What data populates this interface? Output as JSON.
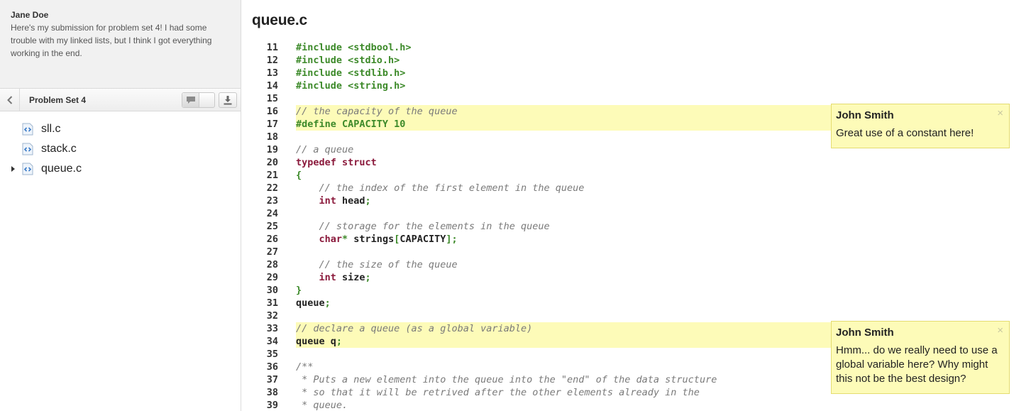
{
  "submission": {
    "author": "Jane Doe",
    "message": "Here's my submission for problem set 4! I had some trouble with my linked lists, but I think I got everything working in the end."
  },
  "problem_set": {
    "title": "Problem Set 4",
    "back_icon": "chevron-left-icon",
    "comment_icon": "speech-bubble-icon",
    "download_icon": "download-icon"
  },
  "files": [
    {
      "name": "sll.c",
      "icon": "code-file-icon",
      "expanded": false
    },
    {
      "name": "stack.c",
      "icon": "code-file-icon",
      "expanded": false
    },
    {
      "name": "queue.c",
      "icon": "code-file-icon",
      "expanded": true
    }
  ],
  "editor": {
    "file_title": "queue.c",
    "lines": [
      {
        "n": "11",
        "text": "#include <stdbool.h>",
        "kind": "pre",
        "hl": false
      },
      {
        "n": "12",
        "text": "#include <stdio.h>",
        "kind": "pre",
        "hl": false
      },
      {
        "n": "13",
        "text": "#include <stdlib.h>",
        "kind": "pre",
        "hl": false
      },
      {
        "n": "14",
        "text": "#include <string.h>",
        "kind": "pre",
        "hl": false
      },
      {
        "n": "15",
        "text": "",
        "kind": "id",
        "hl": false
      },
      {
        "n": "16",
        "text": "// the capacity of the queue",
        "kind": "com",
        "hl": true
      },
      {
        "n": "17",
        "text": "#define CAPACITY 10",
        "kind": "pre",
        "hl": true
      },
      {
        "n": "18",
        "text": "",
        "kind": "id",
        "hl": false
      },
      {
        "n": "19",
        "text": "// a queue",
        "kind": "com",
        "hl": false
      },
      {
        "n": "20",
        "text": "typedef struct",
        "kind": "kw",
        "hl": false
      },
      {
        "n": "21",
        "text": "{",
        "kind": "pun",
        "hl": false
      },
      {
        "n": "22",
        "text": "    // the index of the first element in the queue",
        "kind": "com",
        "hl": false
      },
      {
        "n": "23",
        "text": "    int head;",
        "kind": "mixed",
        "hl": false
      },
      {
        "n": "24",
        "text": "",
        "kind": "id",
        "hl": false
      },
      {
        "n": "25",
        "text": "    // storage for the elements in the queue",
        "kind": "com",
        "hl": false
      },
      {
        "n": "26",
        "text": "    char* strings[CAPACITY];",
        "kind": "mixed",
        "hl": false
      },
      {
        "n": "27",
        "text": "",
        "kind": "id",
        "hl": false
      },
      {
        "n": "28",
        "text": "    // the size of the queue",
        "kind": "com",
        "hl": false
      },
      {
        "n": "29",
        "text": "    int size;",
        "kind": "mixed",
        "hl": false
      },
      {
        "n": "30",
        "text": "}",
        "kind": "pun",
        "hl": false
      },
      {
        "n": "31",
        "text": "queue;",
        "kind": "mixed",
        "hl": false
      },
      {
        "n": "32",
        "text": "",
        "kind": "id",
        "hl": false
      },
      {
        "n": "33",
        "text": "// declare a queue (as a global variable)",
        "kind": "com",
        "hl": true
      },
      {
        "n": "34",
        "text": "queue q;",
        "kind": "mixed",
        "hl": true
      },
      {
        "n": "35",
        "text": "",
        "kind": "id",
        "hl": false
      },
      {
        "n": "36",
        "text": "/**",
        "kind": "com",
        "hl": false
      },
      {
        "n": "37",
        "text": " * Puts a new element into the queue into the \"end\" of the data structure",
        "kind": "com",
        "hl": false
      },
      {
        "n": "38",
        "text": " * so that it will be retrived after the other elements already in the",
        "kind": "com",
        "hl": false
      },
      {
        "n": "39",
        "text": " * queue.",
        "kind": "com",
        "hl": false
      }
    ]
  },
  "comments": [
    {
      "author": "John Smith",
      "body": "Great use of a constant here!",
      "close": "×"
    },
    {
      "author": "John Smith",
      "body": "Hmm... do we really need to use a global variable here? Why might this not be the best design?",
      "close": "×"
    }
  ],
  "colors": {
    "highlight": "#fdfbb8",
    "preprocessor": "#3d8a2a",
    "comment": "#7a7a7a",
    "keyword": "#8b1a3c"
  }
}
